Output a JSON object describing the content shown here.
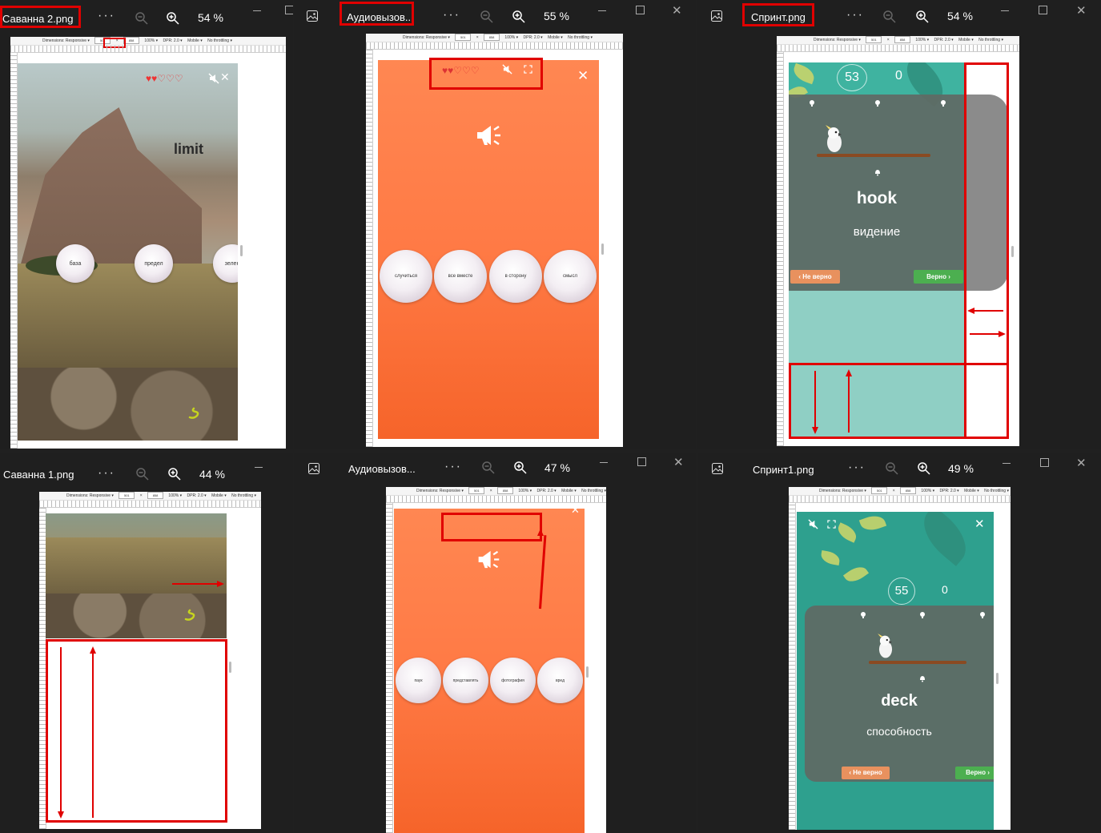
{
  "windows": [
    {
      "id": "w1",
      "title": "Саванна 2.png",
      "zoom": "54 %"
    },
    {
      "id": "w2",
      "title": "Аудиовызов...",
      "zoom": "55 %"
    },
    {
      "id": "w3",
      "title": "Спринт.png",
      "zoom": "54 %"
    },
    {
      "id": "w4",
      "title": "Саванна 1.png",
      "zoom": "44 %"
    },
    {
      "id": "w5",
      "title": "Аудиовызов...",
      "zoom": "47 %"
    },
    {
      "id": "w6",
      "title": "Спринт1.png",
      "zoom": "49 %"
    }
  ],
  "titlebar": {
    "dots": "···",
    "close": "✕"
  },
  "devtools": {
    "dimensions": "Dimensions: Responsive ▾",
    "width": "501",
    "height": "858",
    "x": "×",
    "zoom": "100% ▾",
    "dpr": "DPR: 2.0 ▾",
    "mobile": "Mobile ▾",
    "throttle": "No throttling ▾"
  },
  "savanna2": {
    "word": "limit",
    "options": [
      "база",
      "предел",
      "зелен"
    ]
  },
  "audio1": {
    "options": [
      "случиться",
      "все вместе",
      "в сторону",
      "смысл"
    ]
  },
  "audio2": {
    "options": [
      "паук",
      "представлять",
      "фотография",
      "вред"
    ]
  },
  "sprint1": {
    "score": "53",
    "points": "0",
    "word": "hook",
    "translation": "видение",
    "wrong": "‹ Не верно",
    "right": "Верно ›"
  },
  "sprint2": {
    "score": "55",
    "points": "0",
    "word": "deck",
    "translation": "способность",
    "wrong": "‹ Не верно",
    "right": "Верно ›"
  },
  "colors": {
    "annotation": "#e00000",
    "orange": "#ff7a45",
    "jungle": "#3fb3a0",
    "heart": "#e33"
  },
  "hearts": "♥♥♡♡♡"
}
